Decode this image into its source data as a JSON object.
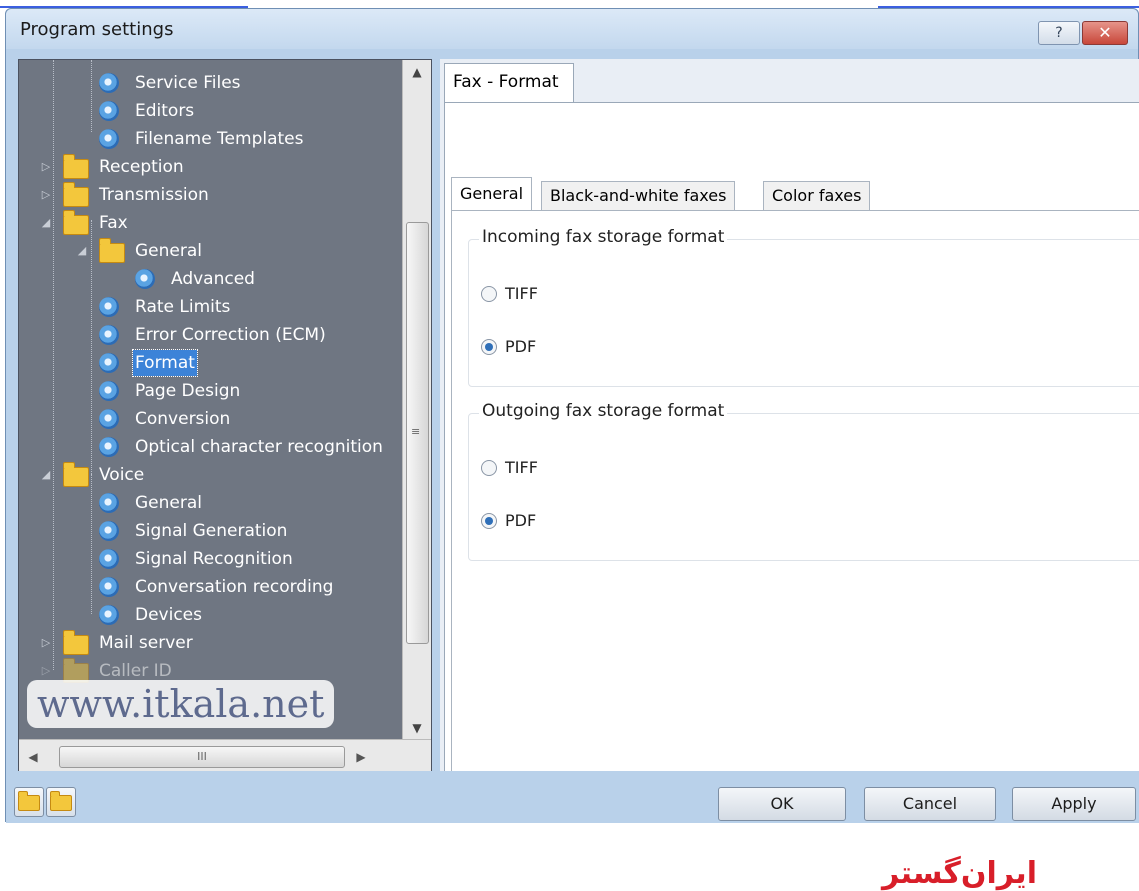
{
  "window": {
    "title": "Program settings",
    "help_icon": "?",
    "close_icon": "✕"
  },
  "tree": {
    "items": [
      {
        "label": "Service Files",
        "icon": "gear-icon"
      },
      {
        "label": "Editors",
        "icon": "gear-icon"
      },
      {
        "label": "Filename Templates",
        "icon": "gear-icon"
      },
      {
        "label": "Reception",
        "icon": "folder-icon",
        "expander": "▷"
      },
      {
        "label": "Transmission",
        "icon": "folder-icon",
        "expander": "▷"
      },
      {
        "label": "Fax",
        "icon": "folder-icon",
        "expander": "◢"
      },
      {
        "label": "General",
        "icon": "folder-icon",
        "expander": "◢"
      },
      {
        "label": "Advanced",
        "icon": "gear-icon"
      },
      {
        "label": "Rate Limits",
        "icon": "gear-icon"
      },
      {
        "label": "Error Correction (ECM)",
        "icon": "gear-icon"
      },
      {
        "label": "Format",
        "icon": "gear-icon",
        "selected": true
      },
      {
        "label": "Page Design",
        "icon": "gear-icon"
      },
      {
        "label": "Conversion",
        "icon": "gear-icon"
      },
      {
        "label": "Optical character recognition",
        "icon": "gear-icon"
      },
      {
        "label": "Voice",
        "icon": "folder-icon",
        "expander": "◢"
      },
      {
        "label": "General",
        "icon": "gear-icon"
      },
      {
        "label": "Signal Generation",
        "icon": "gear-icon"
      },
      {
        "label": "Signal Recognition",
        "icon": "gear-icon"
      },
      {
        "label": "Conversation recording",
        "icon": "gear-icon"
      },
      {
        "label": "Devices",
        "icon": "gear-icon"
      },
      {
        "label": "Mail server",
        "icon": "folder-icon",
        "expander": "▷"
      },
      {
        "label": "Caller ID",
        "icon": "folder-icon",
        "expander": "▷"
      }
    ],
    "scroll": {
      "up": "▲",
      "down": "▼",
      "grip": "≡",
      "left": "◀",
      "right": "▶",
      "hgrip": "III"
    }
  },
  "watermark": "www.itkala.net",
  "panel": {
    "outer_tab": "Fax - Format",
    "tabs": [
      "General",
      "Black-and-white faxes",
      "Color faxes"
    ],
    "incoming": {
      "title": "Incoming fax storage format",
      "options": [
        "TIFF",
        "PDF"
      ],
      "selected": "PDF"
    },
    "outgoing": {
      "title": "Outgoing fax storage format",
      "options": [
        "TIFF",
        "PDF"
      ],
      "selected": "PDF"
    }
  },
  "brand_logo": "ایران‌گستر",
  "buttons": {
    "ok": "OK",
    "cancel": "Cancel",
    "apply": "Apply"
  }
}
